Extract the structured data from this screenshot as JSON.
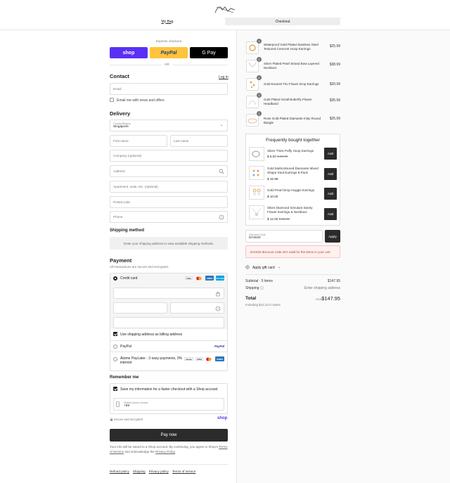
{
  "header": {
    "logo_text": "Xovesa",
    "tabs": [
      {
        "label": "My Bag"
      },
      {
        "label": "Checkout"
      }
    ]
  },
  "express": {
    "title": "Express checkout",
    "shop_label": "shop",
    "paypal_label": "PayPal",
    "gpay_label": "G Pay",
    "or_label": "OR",
    "colors": {
      "shop": "#5a31f4",
      "paypal": "#ffc439",
      "gpay": "#000000"
    }
  },
  "contact": {
    "title": "Contact",
    "login_label": "Log in",
    "email_placeholder": "Email",
    "news_label": "Email me with news and offers"
  },
  "delivery": {
    "title": "Delivery",
    "country_label": "Country/Region",
    "country_value": "Singapore",
    "first_name": "First name",
    "last_name": "Last name",
    "company": "Company (optional)",
    "address": "Address",
    "apartment": "Apartment, suite, etc. (optional)",
    "postal": "Postal code",
    "phone": "Phone"
  },
  "shipping": {
    "title": "Shipping method",
    "message": "Enter your shipping address to view available shipping methods."
  },
  "payment": {
    "title": "Payment",
    "subtitle": "All transactions are secure and encrypted.",
    "credit_card": "Credit card",
    "card_brands": [
      "VISA",
      "mastercard",
      "AMEX",
      "UnionPay"
    ],
    "billing_same": "Use shipping address as billing address",
    "paypal": "PayPal",
    "paypal_logo": "PayPal",
    "atome": "Atome PayLater - 3 easy payments, 0% interest",
    "atome_brands": [
      "atome",
      "VISA",
      "mastercard",
      "AMEX"
    ]
  },
  "remember": {
    "title": "Remember me",
    "save_label": "Save my information for a faster checkout with a Shop account",
    "mobile_label": "Mobile phone number",
    "mobile_value": "+65",
    "secure": "Secure and encrypted",
    "shop_logo": "shop"
  },
  "pay_now": "Pay now",
  "legal": {
    "line1": "Your info will be saved to a Shop account. By continuing, you agree to Shop's",
    "tos": "Terms of Service",
    "and": "and acknowledge the",
    "privacy": "Privacy Policy"
  },
  "footer_links": [
    "Refund policy",
    "Shipping",
    "Privacy policy",
    "Terms of service"
  ],
  "cart": {
    "items": [
      {
        "qty": "1",
        "name": "Waterproof Gold Plated Stainless Steel Textured Crescent Hoop Earrings",
        "price": "$25.99"
      },
      {
        "qty": "1",
        "name": "Silver Plated Pearl Strand Bow Layered Necklace",
        "price": "$38.99"
      },
      {
        "qty": "1",
        "name": "Gold Enamel Trio Flower Drop Earrings",
        "price": "$20.99"
      },
      {
        "qty": "1",
        "name": "Gold Plated Small Butterfly Flower Headband",
        "price": "$35.99"
      },
      {
        "qty": "1",
        "name": "Rose Gold Plated Diamante Inlay Round Bangle",
        "price": "$25.99"
      }
    ]
  },
  "fbt": {
    "title": "Frequently bought together",
    "add_label": "Add",
    "items": [
      {
        "name": "Silver Thick Puffy Hoop Earrings",
        "price": "$ 5.00",
        "old": "$ 20.99"
      },
      {
        "name": "Gold Multicoloured Diamante Mixed Shape Stud Earrings 8-Pack",
        "price": "$ 16.99",
        "old": ""
      },
      {
        "name": "Gold Pearl Drop Huggie Earrings",
        "price": "$ 10.00",
        "old": ""
      },
      {
        "name": "Silver Diamond Simulant Dainty Flower Earrings & Necklace",
        "price": "$ 12.00",
        "old": "$ 33.99"
      }
    ]
  },
  "discount": {
    "label": "Discount Code",
    "value": "DAIS20",
    "apply": "Apply",
    "error": "DAIS20 discount code isn't valid for the items in your cart"
  },
  "gift_card": "Apply gift card",
  "summary": {
    "subtotal_label": "Subtotal · 5 items",
    "subtotal_value": "$147.95",
    "shipping_label": "Shipping",
    "shipping_value": "Enter shipping address",
    "total_label": "Total",
    "currency": "SGD",
    "total_value": "$147.95",
    "tax_note": "Including $12.22 in taxes"
  }
}
